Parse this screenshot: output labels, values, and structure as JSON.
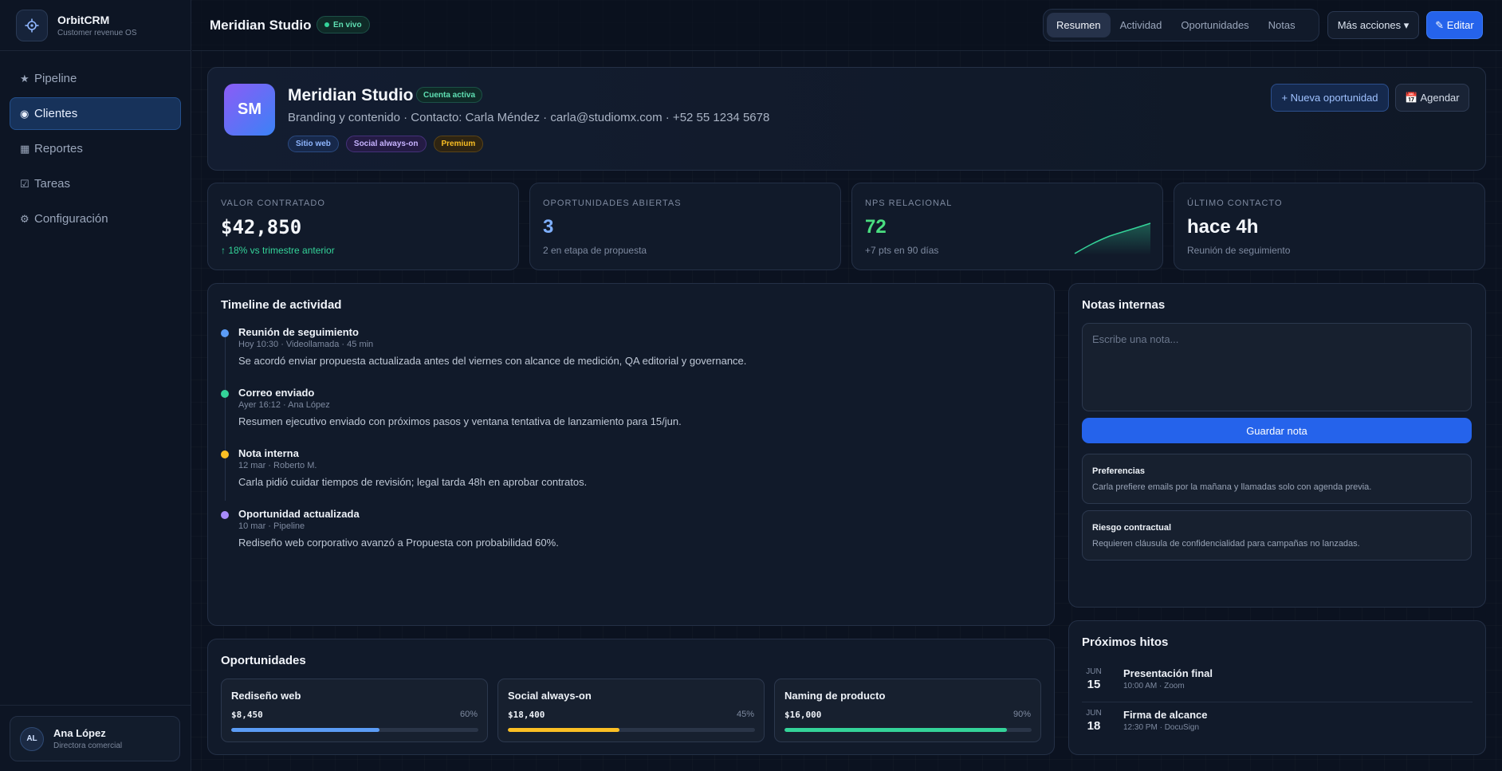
{
  "brand": {
    "name": "OrbitCRM",
    "subtitle": "Customer revenue OS",
    "icon": "crosshair-icon"
  },
  "sidebar": {
    "items": [
      {
        "glyph": "★",
        "label": "Pipeline",
        "active": false
      },
      {
        "glyph": "◉",
        "label": "Clientes",
        "active": true
      },
      {
        "glyph": "▦",
        "label": "Reportes",
        "active": false
      },
      {
        "glyph": "☑",
        "label": "Tareas",
        "active": false
      },
      {
        "glyph": "⚙",
        "label": "Configuración",
        "active": false
      }
    ],
    "user": {
      "initials": "AL",
      "name": "Ana López",
      "role": "Directora comercial"
    }
  },
  "header": {
    "title": "Meridian Studio",
    "live_label": "En vivo",
    "tabs": [
      "Resumen",
      "Actividad",
      "Oportunidades",
      "Notas"
    ],
    "active_tab": "Resumen",
    "more_label": "Más acciones ▾",
    "edit_label": "✎ Editar"
  },
  "client": {
    "initials": "SM",
    "name": "Meridian Studio",
    "status": "Cuenta activa",
    "description": "Branding y contenido · Contacto: Carla Méndez · carla@studiomx.com · +52 55 1234 5678",
    "tags": [
      "Sitio web",
      "Social always-on",
      "Premium"
    ],
    "new_opportunity_label": "+ Nueva oportunidad",
    "schedule_label": "📅 Agendar"
  },
  "stats": [
    {
      "label": "VALOR CONTRATADO",
      "value": "$42,850",
      "sub": "↑ 18% vs trimestre anterior"
    },
    {
      "label": "OPORTUNIDADES ABIERTAS",
      "value": "3",
      "sub": "2 en etapa de propuesta"
    },
    {
      "label": "NPS RELACIONAL",
      "value": "72",
      "sub": "+7 pts en 90 días"
    },
    {
      "label": "ÚLTIMO CONTACTO",
      "value": "hace 4h",
      "sub": "Reunión de seguimiento"
    }
  ],
  "colors": {
    "accent": "#2563eb",
    "positive": "#34d399",
    "opportunities_value": "#7fb0ff",
    "nps_value": "#4ade80"
  },
  "timeline": {
    "title": "Timeline de actividad",
    "items": [
      {
        "color": "#5b9cf6",
        "title": "Reunión de seguimiento",
        "meta": "Hoy 10:30 · Videollamada · 45 min",
        "text": "Se acordó enviar propuesta actualizada antes del viernes con alcance de medición, QA editorial y governance."
      },
      {
        "color": "#34d399",
        "title": "Correo enviado",
        "meta": "Ayer 16:12 · Ana López",
        "text": "Resumen ejecutivo enviado con próximos pasos y ventana tentativa de lanzamiento para 15/jun."
      },
      {
        "color": "#fbbf24",
        "title": "Nota interna",
        "meta": "12 mar · Roberto M.",
        "text": "Carla pidió cuidar tiempos de revisión; legal tarda 48h en aprobar contratos."
      },
      {
        "color": "#a78bfa",
        "title": "Oportunidad actualizada",
        "meta": "10 mar · Pipeline",
        "text": "Rediseño web corporativo avanzó a Propuesta con probabilidad 60%."
      }
    ]
  },
  "notes": {
    "title": "Notas internas",
    "placeholder": "Escribe una nota...",
    "value": "",
    "save_label": "Guardar nota",
    "cards": [
      {
        "title": "Preferencias",
        "text": "Carla prefiere emails por la mañana y llamadas solo con agenda previa."
      },
      {
        "title": "Riesgo contractual",
        "text": "Requieren cláusula de confidencialidad para campañas no lanzadas."
      }
    ]
  },
  "opportunities": {
    "title": "Oportunidades",
    "items": [
      {
        "name": "Rediseño web",
        "amount": "$8,450",
        "pct_label": "60%",
        "progress": 0.6,
        "color": "#5b9cf6"
      },
      {
        "name": "Social always-on",
        "amount": "$18,400",
        "pct_label": "45%",
        "progress": 0.45,
        "color": "#fbbf24"
      },
      {
        "name": "Naming de producto",
        "amount": "$16,000",
        "pct_label": "90%",
        "progress": 0.9,
        "color": "#34d399"
      }
    ]
  },
  "milestones": {
    "title": "Próximos hitos",
    "items": [
      {
        "month": "JUN",
        "day": "15",
        "title": "Presentación final",
        "meta": "10:00 AM · Zoom"
      },
      {
        "month": "JUN",
        "day": "18",
        "title": "Firma de alcance",
        "meta": "12:30 PM · DocuSign"
      }
    ]
  }
}
